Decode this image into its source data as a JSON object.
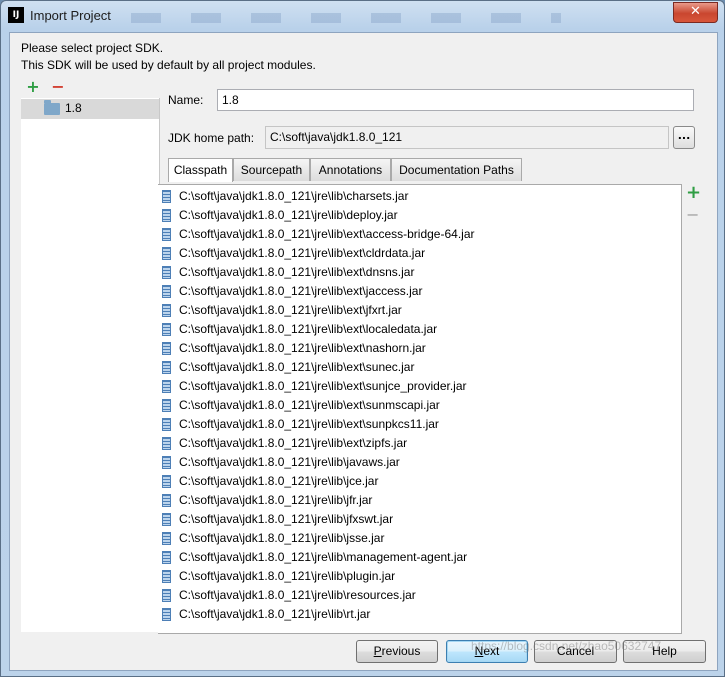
{
  "window": {
    "title": "Import Project",
    "app_icon_text": "IJ",
    "close_glyph": "✕"
  },
  "intro": {
    "line1": "Please select project SDK.",
    "line2": "This SDK will be used by default by all project modules."
  },
  "sdk_toolbar": {
    "add_icon": "plus-icon",
    "remove_icon": "minus-icon",
    "add_glyph": "+",
    "remove_glyph": "−"
  },
  "sdk_list": [
    {
      "label": "1.8",
      "icon": "folder-icon",
      "selected": true
    }
  ],
  "form": {
    "name_label": "Name:",
    "name_value": "1.8",
    "jdk_label": "JDK home path:",
    "jdk_value": "C:\\soft\\java\\jdk1.8.0_121",
    "browse_label": "..."
  },
  "tabs": [
    {
      "label": "Classpath",
      "active": true
    },
    {
      "label": "Sourcepath",
      "active": false
    },
    {
      "label": "Annotations",
      "active": false
    },
    {
      "label": "Documentation Paths",
      "active": false
    }
  ],
  "classpath": [
    "C:\\soft\\java\\jdk1.8.0_121\\jre\\lib\\charsets.jar",
    "C:\\soft\\java\\jdk1.8.0_121\\jre\\lib\\deploy.jar",
    "C:\\soft\\java\\jdk1.8.0_121\\jre\\lib\\ext\\access-bridge-64.jar",
    "C:\\soft\\java\\jdk1.8.0_121\\jre\\lib\\ext\\cldrdata.jar",
    "C:\\soft\\java\\jdk1.8.0_121\\jre\\lib\\ext\\dnsns.jar",
    "C:\\soft\\java\\jdk1.8.0_121\\jre\\lib\\ext\\jaccess.jar",
    "C:\\soft\\java\\jdk1.8.0_121\\jre\\lib\\ext\\jfxrt.jar",
    "C:\\soft\\java\\jdk1.8.0_121\\jre\\lib\\ext\\localedata.jar",
    "C:\\soft\\java\\jdk1.8.0_121\\jre\\lib\\ext\\nashorn.jar",
    "C:\\soft\\java\\jdk1.8.0_121\\jre\\lib\\ext\\sunec.jar",
    "C:\\soft\\java\\jdk1.8.0_121\\jre\\lib\\ext\\sunjce_provider.jar",
    "C:\\soft\\java\\jdk1.8.0_121\\jre\\lib\\ext\\sunmscapi.jar",
    "C:\\soft\\java\\jdk1.8.0_121\\jre\\lib\\ext\\sunpkcs11.jar",
    "C:\\soft\\java\\jdk1.8.0_121\\jre\\lib\\ext\\zipfs.jar",
    "C:\\soft\\java\\jdk1.8.0_121\\jre\\lib\\javaws.jar",
    "C:\\soft\\java\\jdk1.8.0_121\\jre\\lib\\jce.jar",
    "C:\\soft\\java\\jdk1.8.0_121\\jre\\lib\\jfr.jar",
    "C:\\soft\\java\\jdk1.8.0_121\\jre\\lib\\jfxswt.jar",
    "C:\\soft\\java\\jdk1.8.0_121\\jre\\lib\\jsse.jar",
    "C:\\soft\\java\\jdk1.8.0_121\\jre\\lib\\management-agent.jar",
    "C:\\soft\\java\\jdk1.8.0_121\\jre\\lib\\plugin.jar",
    "C:\\soft\\java\\jdk1.8.0_121\\jre\\lib\\resources.jar",
    "C:\\soft\\java\\jdk1.8.0_121\\jre\\lib\\rt.jar"
  ],
  "classpath_toolbar": {
    "add_icon": "plus-icon",
    "remove_icon": "minus-icon",
    "add_glyph": "+",
    "remove_glyph": "−"
  },
  "buttons": {
    "previous_mnemonic": "P",
    "previous_rest": "revious",
    "next_mnemonic": "N",
    "next_rest": "ext",
    "cancel": "Cancel",
    "help": "Help"
  },
  "watermark": "https://blog.csdn.net/zhao50632747",
  "colors": {
    "add_green": "#2f9e44",
    "remove_red": "#d23f31",
    "remove_disabled": "#b8b8b8",
    "close_red": "#c9462f"
  }
}
